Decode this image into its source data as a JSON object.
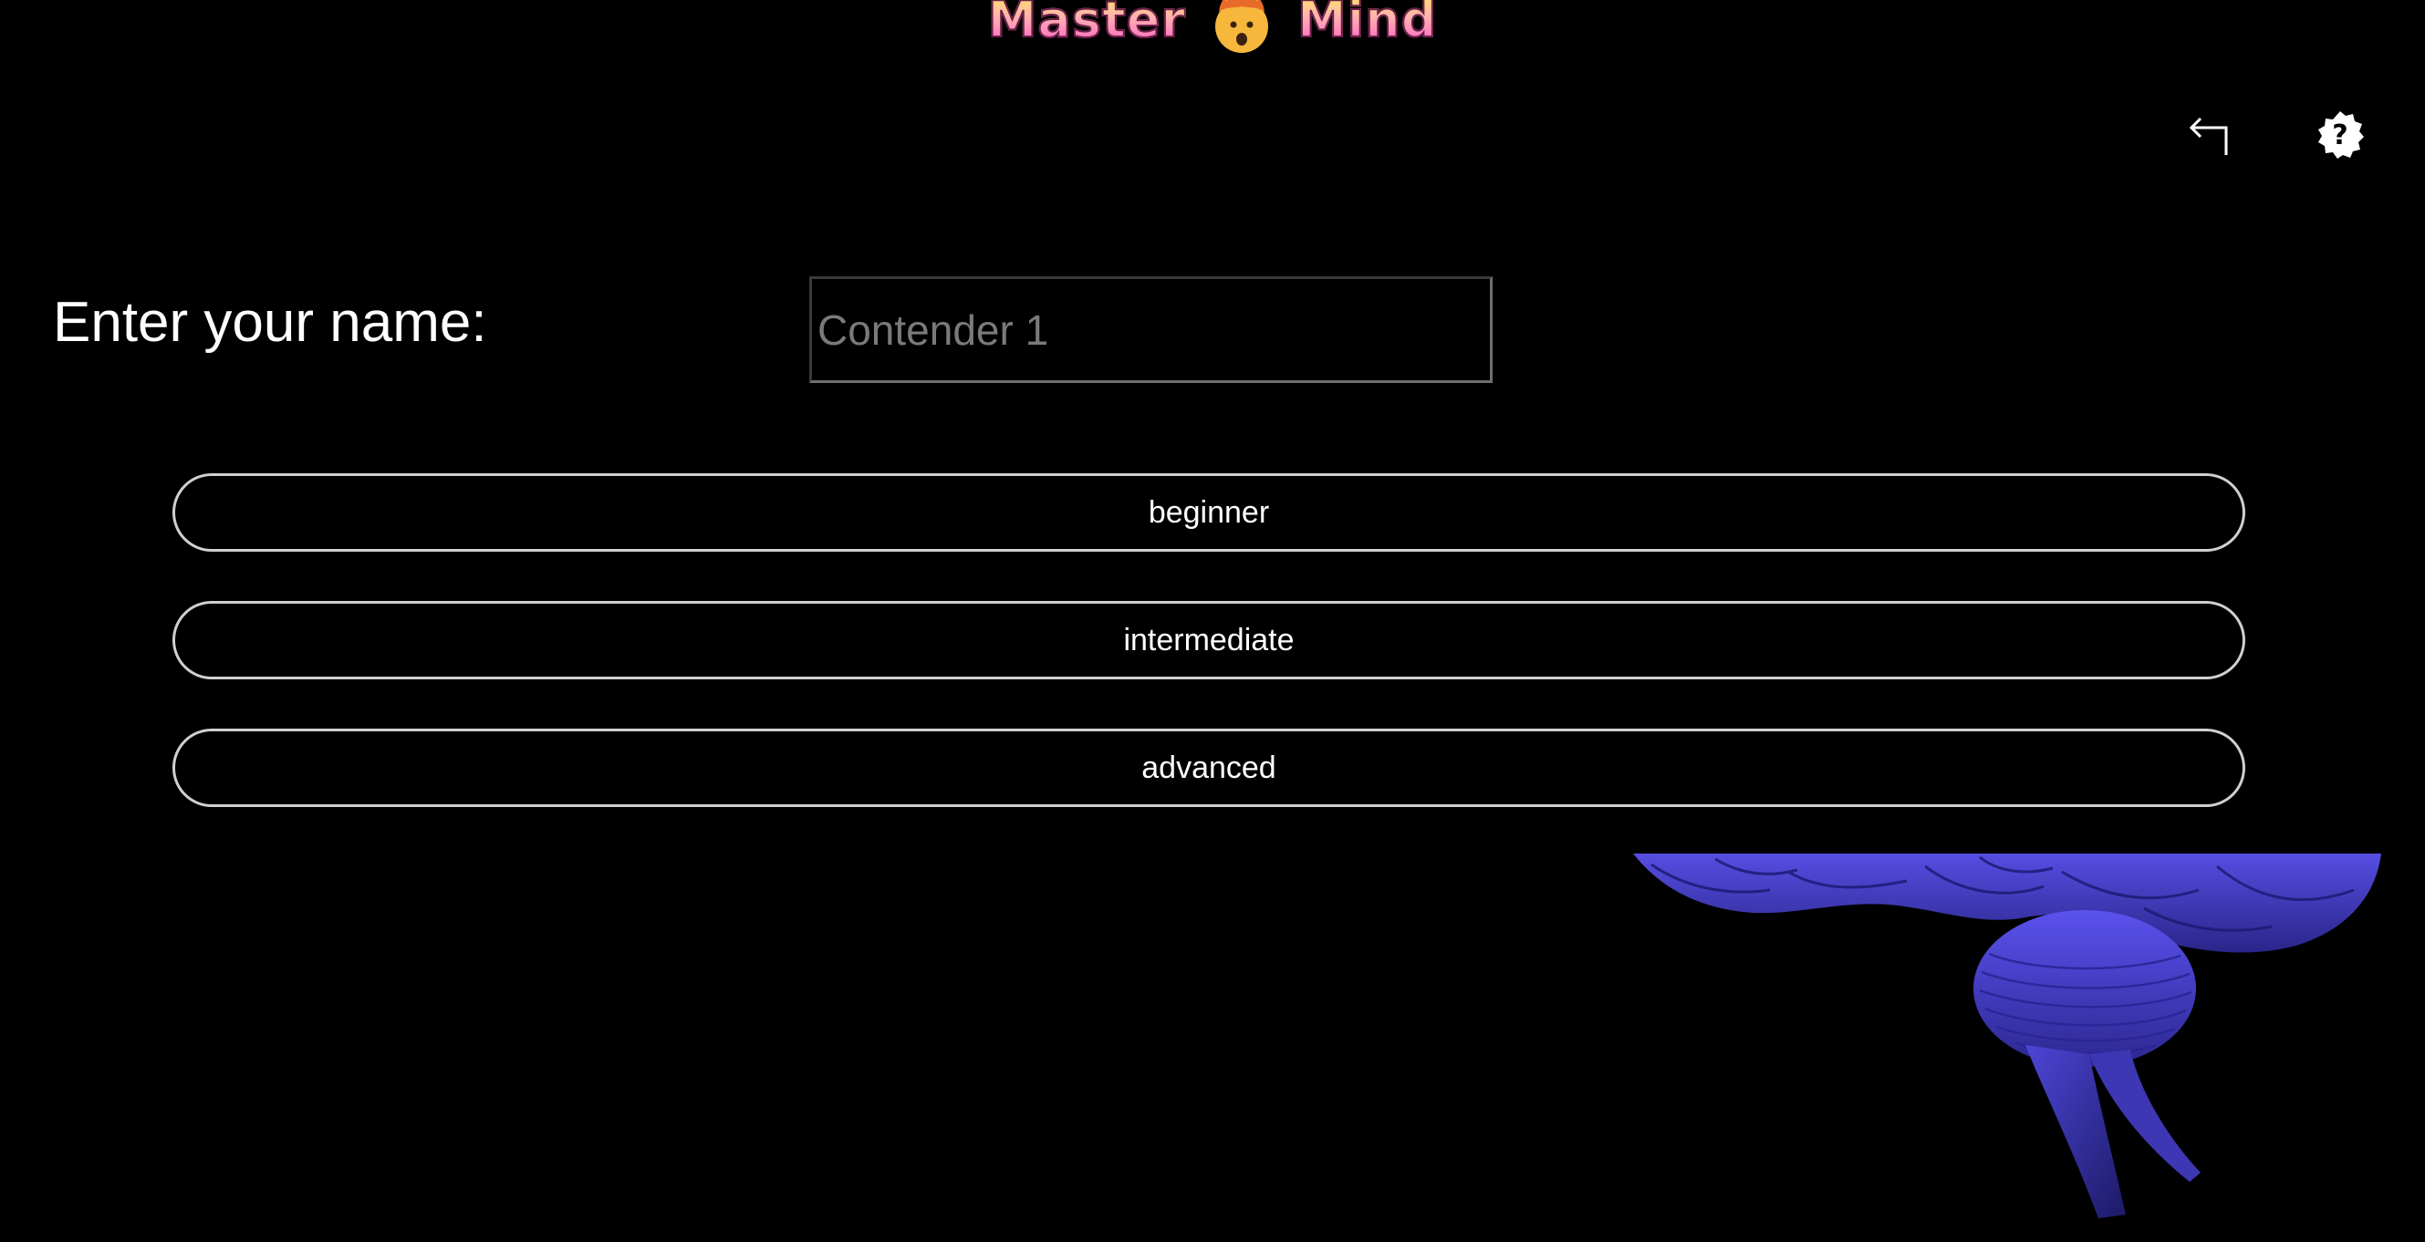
{
  "header": {
    "title_left": "Master",
    "title_right": "Mind",
    "title_emoji_icon": "exploding-head-icon",
    "accent_gradient": [
      "#ffe36a",
      "#ffb0b0",
      "#ff63c3"
    ]
  },
  "toolbar": {
    "back_icon": "back-arrow-icon",
    "help_icon": "help-badge-icon"
  },
  "form": {
    "name_label": "Enter your name:",
    "name_value": "",
    "name_placeholder": "Contender 1"
  },
  "levels": [
    {
      "id": "beginner",
      "label": "beginner"
    },
    {
      "id": "intermediate",
      "label": "intermediate"
    },
    {
      "id": "advanced",
      "label": "advanced"
    }
  ],
  "colors": {
    "background": "#000000",
    "button_border": "#d0d0d0",
    "brain_art": "#4a43d6"
  }
}
